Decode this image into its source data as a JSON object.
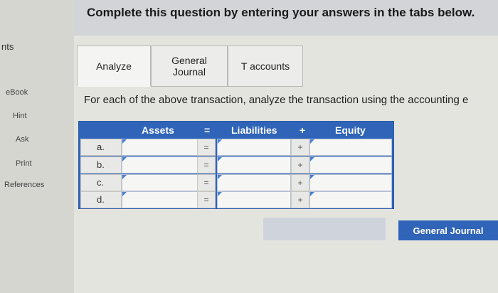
{
  "header": {
    "instruction": "Complete this question by entering your answers in the tabs below."
  },
  "sidebar": {
    "partial_label": "nts",
    "items": [
      {
        "label": "eBook"
      },
      {
        "label": "Hint"
      },
      {
        "label": "Ask"
      },
      {
        "label": "Print"
      },
      {
        "label": "References"
      }
    ]
  },
  "tabs": [
    {
      "label": "Analyze",
      "active": true
    },
    {
      "label": "General Journal",
      "active": false
    },
    {
      "label": "T accounts",
      "active": false
    }
  ],
  "prompt": "For each of the above transaction, analyze the transaction using the accounting e",
  "table": {
    "headers": {
      "assets": "Assets",
      "eq": "=",
      "liabilities": "Liabilities",
      "plus": "+",
      "equity": "Equity"
    },
    "rows": [
      {
        "label": "a.",
        "op1": "=",
        "op2": "+"
      },
      {
        "label": "b.",
        "op1": "=",
        "op2": "+"
      },
      {
        "label": "c.",
        "op1": "=",
        "op2": "+"
      },
      {
        "label": "d.",
        "op1": "=",
        "op2": "+"
      }
    ]
  },
  "buttons": {
    "next": "General Journal"
  }
}
